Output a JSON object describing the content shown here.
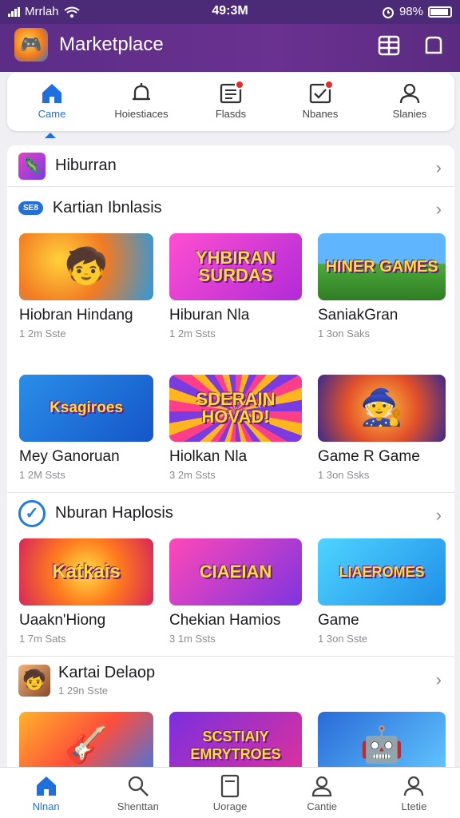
{
  "status_bar": {
    "carrier": "Mrrlah",
    "time": "49:3M",
    "battery": "98%"
  },
  "app_bar": {
    "title": "Marketplace"
  },
  "top_nav": [
    {
      "label": "Came",
      "icon": "home-icon",
      "active": true
    },
    {
      "label": "Hoiestiaces",
      "icon": "bell-icon",
      "active": false
    },
    {
      "label": "Flasds",
      "icon": "document-icon",
      "active": false
    },
    {
      "label": "Nbanes",
      "icon": "checkbox-icon",
      "active": false
    },
    {
      "label": "Slanies",
      "icon": "person-icon",
      "active": false
    }
  ],
  "sections": {
    "hiburran": {
      "title": "Hiburran"
    },
    "kartian": {
      "pill": "SE8",
      "title": "Kartian Ibnlasis",
      "cards": [
        {
          "name": "Hiobran Hindang",
          "meta": "1 2m Sste",
          "thumb_text": ""
        },
        {
          "name": "Hiburan Nla",
          "meta": "1 2m Ssts",
          "thumb_text": "YHBIRAN SURDAS"
        },
        {
          "name": "SaniakGran",
          "meta": "1 3on Saks",
          "thumb_text": "HINER GAMES"
        },
        {
          "name": "Mey Ganoruan",
          "meta": "1 2M Ssts",
          "thumb_text": "Ksagiroes"
        },
        {
          "name": "Hiolkan Nla",
          "meta": "3 2m Ssts",
          "thumb_text": "SDERAIN HOVAD!"
        },
        {
          "name": "Game R Game",
          "meta": "1 3on Ssks",
          "thumb_text": ""
        }
      ]
    },
    "nburan": {
      "title": "Nburan Haplosis",
      "cards": [
        {
          "name": "Uaakn'Hiong",
          "meta": "1 7m Sats",
          "thumb_text": "Katkais"
        },
        {
          "name": "Chekian Hamios",
          "meta": "3 1m Ssts",
          "thumb_text": "CIAEIAN"
        },
        {
          "name": "Game",
          "meta": "1 3on Sste",
          "thumb_text": "LIAEROMES"
        }
      ]
    },
    "kartai": {
      "title": "Kartai Delaop",
      "meta": "1 29n Sste",
      "cards": [
        {
          "thumb_text": ""
        },
        {
          "thumb_text": "SCSTIAIY EMRYTROES"
        },
        {
          "thumb_text": ""
        }
      ]
    }
  },
  "bottom_nav": [
    {
      "label": "Nlnan",
      "icon": "home-icon",
      "active": true
    },
    {
      "label": "Shenttan",
      "icon": "search-icon",
      "active": false
    },
    {
      "label": "Uorage",
      "icon": "document-icon",
      "active": false
    },
    {
      "label": "Cantie",
      "icon": "person-icon",
      "active": false
    },
    {
      "label": "Ltetie",
      "icon": "person-icon",
      "active": false
    }
  ],
  "colors": {
    "accent": "#1f6fe0",
    "appbar": "#5b2d86",
    "badge": "#e02e2e"
  }
}
